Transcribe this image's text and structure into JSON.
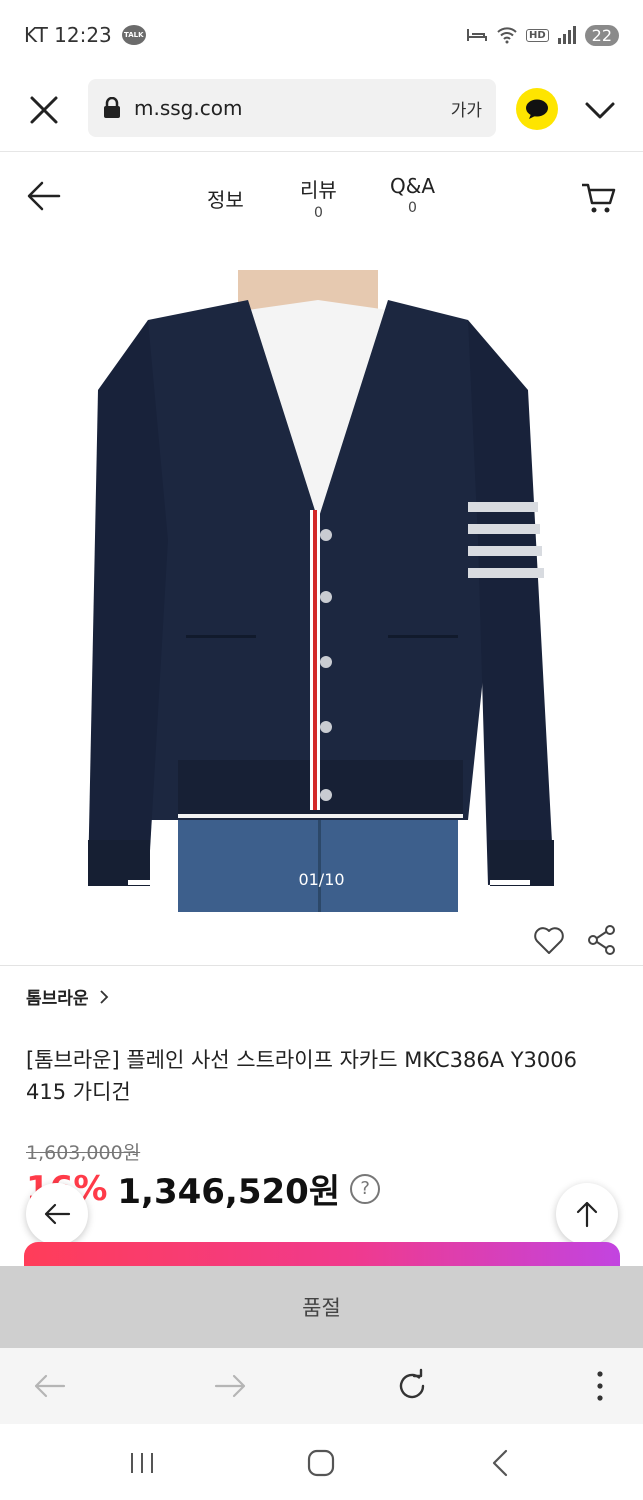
{
  "status_bar": {
    "carrier_time": "KT 12:23",
    "talk_badge": "TALK",
    "hd": "HD",
    "battery": "22"
  },
  "browser": {
    "url": "m.ssg.com",
    "font_size_label": "가가"
  },
  "header": {
    "tabs": [
      {
        "label": "정보",
        "count": ""
      },
      {
        "label": "리뷰",
        "count": "0"
      },
      {
        "label": "Q&A",
        "count": "0"
      }
    ]
  },
  "product": {
    "image_counter": "01/10",
    "brand": "톰브라운",
    "title": "[톰브라운] 플레인 사선 스트라이프 자카드 MKC386A Y3006 415 가디건",
    "original_price": "1,603,000원",
    "discount": "16%",
    "price": "1,346,520원",
    "help": "?"
  },
  "cta": {
    "soldout_label": "품절"
  },
  "icons": {
    "close": "close-icon",
    "lock": "lock-icon",
    "kakao": "kakao-talk-icon",
    "back": "back-arrow-icon",
    "cart": "cart-icon",
    "heart": "heart-icon",
    "share": "share-icon",
    "scroll_top": "arrow-up-icon",
    "reload": "reload-icon",
    "more": "more-vertical-icon"
  },
  "colors": {
    "discount": "#ff3b49",
    "kakao": "#fee500",
    "soldout_bg": "#cfcfcf",
    "gradient_start": "#ff3d59",
    "gradient_end": "#c244e0"
  }
}
